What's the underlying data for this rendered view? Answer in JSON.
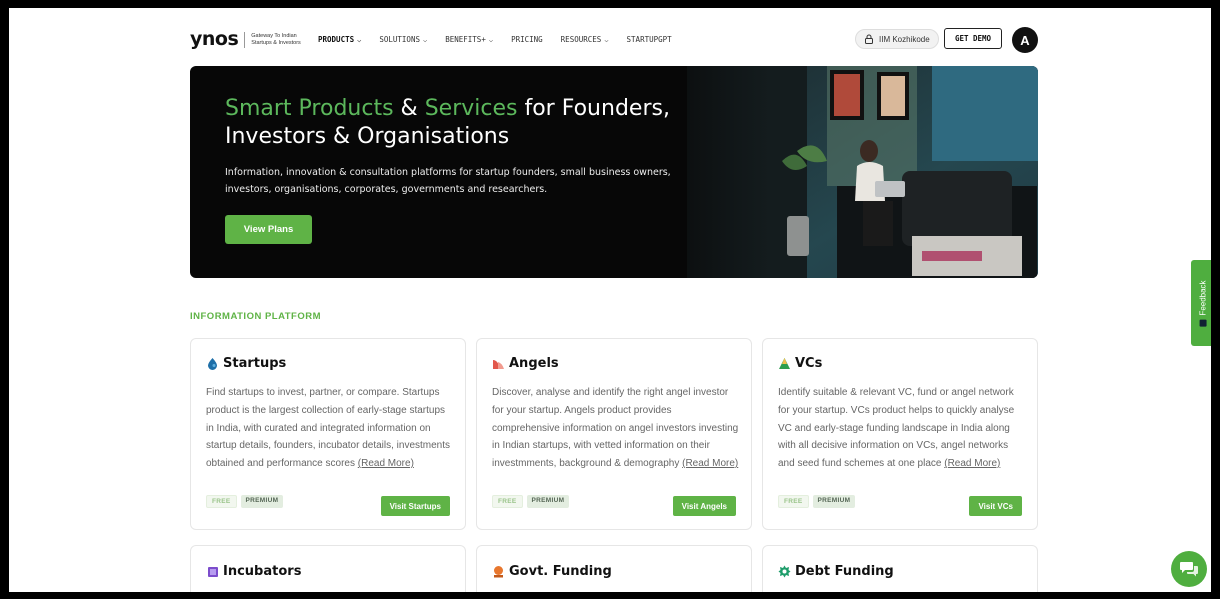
{
  "header": {
    "logo": "ynos",
    "tagline_line1": "Gateway To Indian",
    "tagline_line2": "Startups & Investors",
    "nav": [
      {
        "label": "PRODUCTS",
        "dropdown": true
      },
      {
        "label": "SOLUTIONS",
        "dropdown": true
      },
      {
        "label": "BENEFITS+",
        "dropdown": true
      },
      {
        "label": "PRICING",
        "dropdown": false
      },
      {
        "label": "RESOURCES",
        "dropdown": true
      },
      {
        "label": "STARTUPGPT",
        "dropdown": false
      }
    ],
    "org_pill": "IIM Kozhikode",
    "demo_button": "GET DEMO",
    "avatar_letter": "A"
  },
  "hero": {
    "title_part1": "Smart Products",
    "title_part2": " & ",
    "title_part3": "Services",
    "title_part4": " for Founders,",
    "title_line2": "Investors & Organisations",
    "subtitle": "Information, innovation & consultation platforms for startup founders, small business owners, investors, organisations, corporates, governments and researchers.",
    "button": "View Plans"
  },
  "section_label": "INFORMATION PLATFORM",
  "cards": [
    {
      "title": "Startups",
      "description": "Find startups to invest, partner, or compare. Startups product is the largest collection of early-stage startups in India, with curated and integrated information on startup details, founders, incubator details, investments obtained and performance scores ",
      "read_more": "(Read More)",
      "badge_free": "FREE",
      "badge_premium": "PREMIUM",
      "button": "Visit Startups"
    },
    {
      "title": "Angels",
      "description": "Discover, analyse and identify the right angel investor for your startup. Angels product provides comprehensive information on angel investors investing in Indian startups, with vetted information on their investmments, background & demography ",
      "read_more": "(Read More)",
      "badge_free": "FREE",
      "badge_premium": "PREMIUM",
      "button": "Visit Angels"
    },
    {
      "title": "VCs",
      "description": "Identify suitable & relevant VC, fund or angel network for your startup. VCs product helps to quickly analyse VC and early-stage funding landscape in India along with all decisive information on VCs, angel networks and seed fund schemes at one place ",
      "read_more": "(Read More)",
      "badge_free": "FREE",
      "badge_premium": "PREMIUM",
      "button": "Visit VCs"
    }
  ],
  "cards_row2": [
    {
      "title": "Incubators"
    },
    {
      "title": "Govt. Funding"
    },
    {
      "title": "Debt Funding"
    }
  ],
  "feedback_label": "Feedback",
  "colors": {
    "accent": "#5fb346",
    "hero_bg": "#070707"
  }
}
